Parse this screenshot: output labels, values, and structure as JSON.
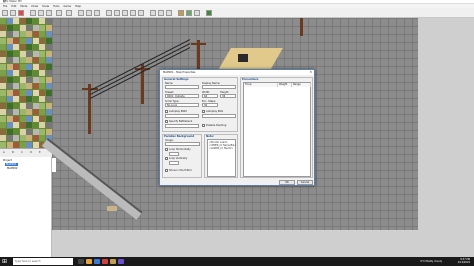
{
  "titlebar": {
    "title": "RPG Maker MV",
    "controls": [
      "–",
      "□",
      "✕"
    ]
  },
  "menu": [
    "File",
    "Edit",
    "Mode",
    "Draw",
    "Scale",
    "Tools",
    "Game",
    "Help"
  ],
  "tileset_tabs": [
    "A",
    "B",
    "C",
    "D",
    "E"
  ],
  "map_tree": [
    {
      "label": "Project",
      "selected": false
    },
    {
      "label": "MAP001",
      "selected": true
    },
    {
      "label": "MAP002",
      "selected": false
    }
  ],
  "dialog": {
    "title": "MAP001 - Map Properties",
    "close": "✕",
    "general_settings": {
      "legend": "General Settings",
      "name_label": "Name:",
      "name_value": "",
      "display_name_label": "Display Name:",
      "display_name_value": "",
      "tileset_label": "Tileset:",
      "tileset_value": "0001: Outside",
      "width_label": "Width:",
      "width_value": "64",
      "height_label": "Height:",
      "height_value": "36",
      "scroll_type_label": "Scroll Type:",
      "scroll_type_value": "No Loop",
      "enc_steps_label": "Enc. Steps:",
      "enc_steps_value": "30",
      "autoplay_bgm_label": "Autoplay BGM",
      "autoplay_bgs_label": "Autoplay BGS",
      "specify_battleback_label": "Specify Battleback",
      "disable_dashing_label": "Disable Dashing"
    },
    "parallax": {
      "legend": "Parallax Background",
      "image_label": "Image:",
      "image_value": "",
      "loop_h_label": "Loop Horizontally",
      "loop_v_label": "Loop Vertically",
      "show_in_editor_label": "Show in the Editor"
    },
    "note": {
      "legend": "Note:",
      "text": "<Stricter Load>\n<UPPER_LY: Name/file>\n<LOWER_LY: file/dir>"
    },
    "encounters": {
      "legend": "Encounters",
      "columns": [
        "Troop",
        "Weight",
        "Range"
      ]
    },
    "buttons": {
      "ok": "OK",
      "cancel": "Cancel"
    }
  },
  "taskbar": {
    "search_placeholder": "Type here to search",
    "tray_text": "6°C  Mostly cloudy",
    "time": "8:37 PM",
    "date": "2/14/2022"
  }
}
